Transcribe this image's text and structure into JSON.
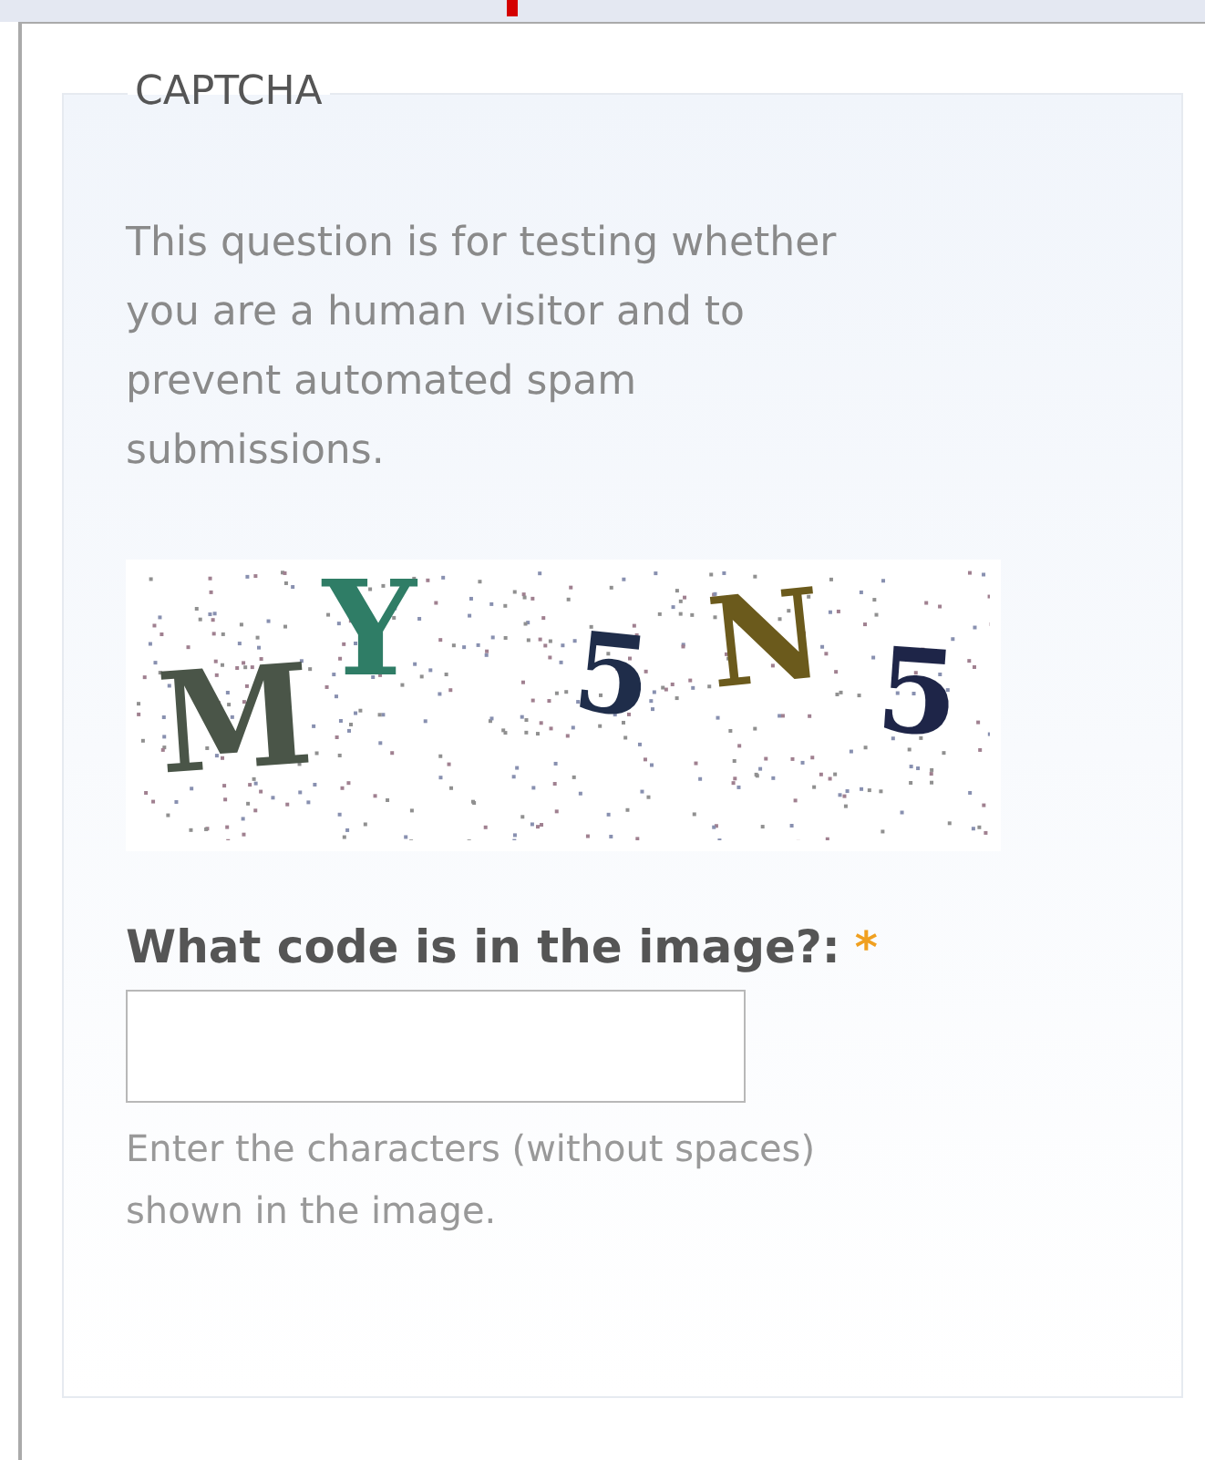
{
  "fieldset": {
    "legend": "CAPTCHA",
    "description": "This question is for testing whether you are a human visitor and to prevent automated spam submissions.",
    "captcha_image": {
      "characters": [
        {
          "char": "M",
          "color": "#4a5548"
        },
        {
          "char": "Y",
          "color": "#2f7d66"
        },
        {
          "char": "5",
          "color": "#1f2d4a"
        },
        {
          "char": "N",
          "color": "#6b5a1c"
        },
        {
          "char": "5",
          "color": "#1e2548"
        }
      ]
    },
    "field": {
      "label": "What code is in the image?:",
      "required": true,
      "required_mark": "*",
      "help": "Enter the characters (without spaces) shown in the image."
    }
  }
}
